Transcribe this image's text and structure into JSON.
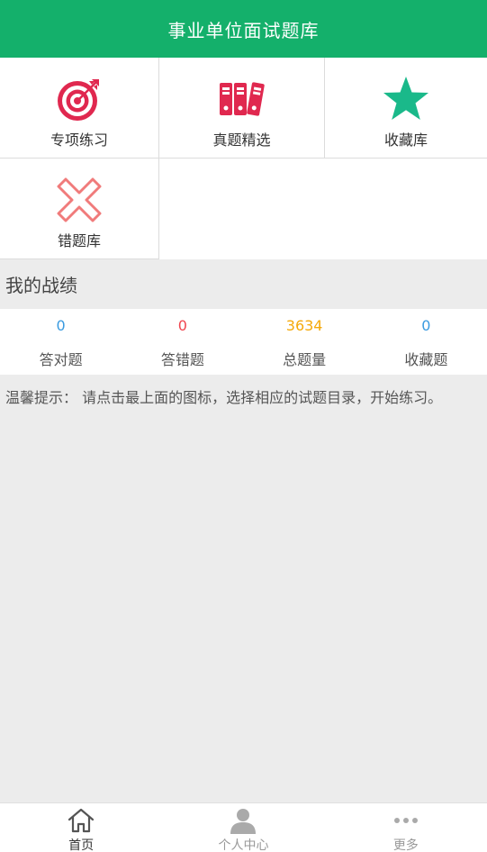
{
  "header": {
    "title": "事业单位面试题库"
  },
  "grid": {
    "items": [
      {
        "label": "专项练习",
        "icon": "target-icon",
        "color": "#e0284f"
      },
      {
        "label": "真题精选",
        "icon": "binders-icon",
        "color": "#e0284f"
      },
      {
        "label": "收藏库",
        "icon": "star-icon",
        "color": "#1ab98a"
      },
      {
        "label": "错题库",
        "icon": "cross-icon",
        "color": "#f07b7b"
      }
    ]
  },
  "record": {
    "title": "我的战绩",
    "stats": [
      {
        "value": "0",
        "label": "答对题",
        "color": "#3a9be0"
      },
      {
        "value": "0",
        "label": "答错题",
        "color": "#f0454f"
      },
      {
        "value": "3634",
        "label": "总题量",
        "color": "#f5a90a"
      },
      {
        "value": "0",
        "label": "收藏题",
        "color": "#3a9be0"
      }
    ]
  },
  "tip": {
    "text": "温馨提示： 请点击最上面的图标，选择相应的试题目录，开始练习。"
  },
  "tabbar": {
    "tabs": [
      {
        "label": "首页",
        "icon": "home-icon",
        "active": true
      },
      {
        "label": "个人中心",
        "icon": "person-icon",
        "active": false
      },
      {
        "label": "更多",
        "icon": "more-dots-icon",
        "active": false
      }
    ]
  },
  "colors": {
    "brand": "#14b06b",
    "background": "#ececec"
  }
}
